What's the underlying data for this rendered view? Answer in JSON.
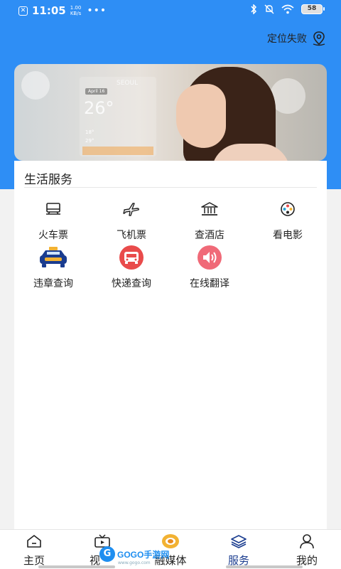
{
  "status_bar": {
    "time": "11:05",
    "speed_value": "1.00",
    "speed_unit": "KB/s",
    "more": "•••",
    "battery": "58"
  },
  "location": {
    "text": "定位失败",
    "icon": "location-pin-icon"
  },
  "banner": {
    "weather_city": "SEOUL",
    "weather_date": "April 16",
    "weather_temp": "26°",
    "weather_low": "18°",
    "weather_high": "29°"
  },
  "services": {
    "title": "生活服务",
    "items": [
      {
        "label": "火车票",
        "icon": "train-icon"
      },
      {
        "label": "飞机票",
        "icon": "airplane-icon"
      },
      {
        "label": "查酒店",
        "icon": "hotel-icon"
      },
      {
        "label": "看电影",
        "icon": "film-reel-icon"
      },
      {
        "label": "违章查询",
        "icon": "taxi-icon"
      },
      {
        "label": "快递查询",
        "icon": "delivery-truck-icon"
      },
      {
        "label": "在线翻译",
        "icon": "speaker-icon"
      }
    ]
  },
  "tabbar": {
    "items": [
      {
        "label": "主页",
        "icon": "home-icon"
      },
      {
        "label": "视",
        "icon": "video-icon"
      },
      {
        "label": "融媒体",
        "icon": "media-icon"
      },
      {
        "label": "服务",
        "icon": "layers-icon"
      },
      {
        "label": "我的",
        "icon": "user-icon"
      }
    ],
    "active": "服务"
  },
  "watermark": {
    "brand": "GOGO手游网",
    "url": "www.gogo.com"
  },
  "colors": {
    "brand_blue": "#2e8ef5",
    "active_tab": "#1a3c8f",
    "red_accent": "#e94b4b",
    "pink_accent": "#f06a78",
    "teal_accent": "#2ea3d6"
  }
}
